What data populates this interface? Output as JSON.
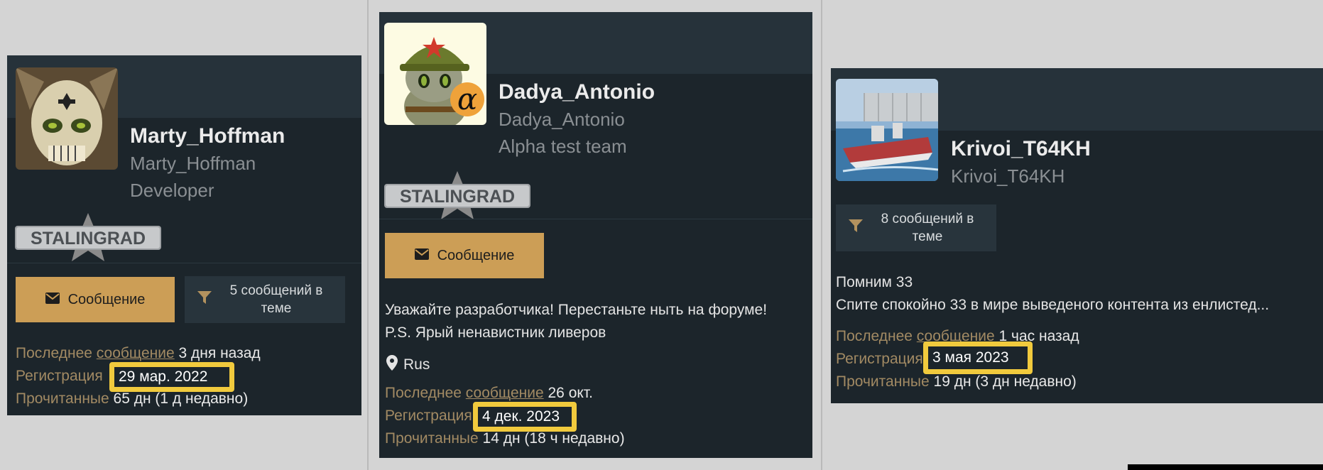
{
  "cards": [
    {
      "name": "Marty_Hoffman",
      "username": "Marty_Hoffman",
      "role": "Developer",
      "badge": "STALINGRAD",
      "message_button": "Сообщение",
      "filter_button": "5 сообщений в теме",
      "last_message_label": "Последнее сообщение",
      "last_message_value": "3 дня назад",
      "registration_label": "Регистрация",
      "registration_value": "29 мар. 2022",
      "read_label": "Прочитанные",
      "read_value": "65 дн (1 д недавно)"
    },
    {
      "name": "Dadya_Antonio",
      "username": "Dadya_Antonio",
      "role": "Alpha test team",
      "alpha_badge": "α",
      "badge": "STALINGRAD",
      "message_button": "Сообщение",
      "bio_line1": "Уважайте разработчика! Перестаньте ныть на форуме!",
      "bio_line2": "P.S. Ярый ненавистник ливеров",
      "location": "Rus",
      "last_message_label": "Последнее сообщение",
      "last_message_value": "26 окт.",
      "registration_label": "Регистрация",
      "registration_value": "4 дек. 2023",
      "read_label": "Прочитанные",
      "read_value": "14 дн (18 ч недавно)"
    },
    {
      "name": "Krivoi_T64KH",
      "username": "Krivoi_T64KH",
      "filter_button": "8 сообщений в теме",
      "about_line1": "Помним 33",
      "about_line2": "Спите спокойно 33 в мире выведеного контента из енлистед...",
      "last_message_label": "Последнее сообщение",
      "last_message_value": "1 час назад",
      "registration_label": "Регистрация",
      "registration_value": "3 мая 2023",
      "read_label": "Прочитанные",
      "read_value": "19 дн (3 дн недавно)"
    }
  ],
  "colors": {
    "card_bg": "#1c252b",
    "card_header": "#26323a",
    "accent": "#cc9e56",
    "label": "#a28a63",
    "highlight": "#f1ca3d"
  },
  "icons": [
    "envelope-icon",
    "filter-icon",
    "map-marker-icon",
    "stalingrad-star-icon"
  ]
}
